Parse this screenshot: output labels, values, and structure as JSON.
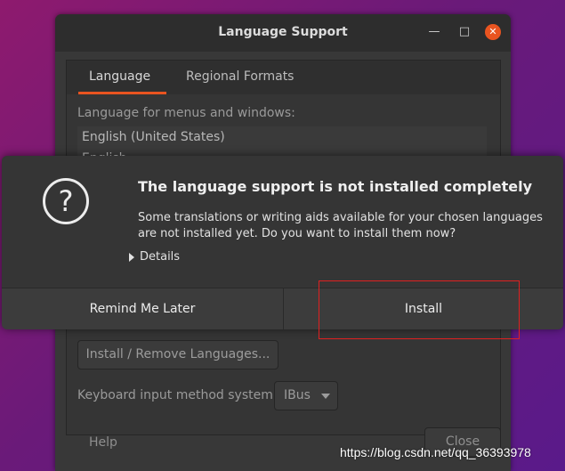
{
  "window": {
    "title": "Language Support",
    "tabs": [
      {
        "label": "Language"
      },
      {
        "label": "Regional Formats"
      }
    ],
    "language_label": "Language for menus and windows:",
    "languages": [
      "English (United States)",
      "English"
    ],
    "install_remove_label": "Install / Remove Languages...",
    "keyboard_label": "Keyboard input method system:",
    "keyboard_value": "IBus",
    "help_label": "Help",
    "close_label": "Close"
  },
  "dialog": {
    "icon": "question-icon",
    "title": "The language support is not installed completely",
    "body": "Some translations or writing aids available for your chosen languages are not installed yet. Do you want to install them now?",
    "details_label": "Details",
    "remind_label": "Remind Me Later",
    "install_label": "Install"
  },
  "watermark": "https://blog.csdn.net/qq_36393978",
  "colors": {
    "accent": "#e95420",
    "highlight": "#e02020"
  }
}
